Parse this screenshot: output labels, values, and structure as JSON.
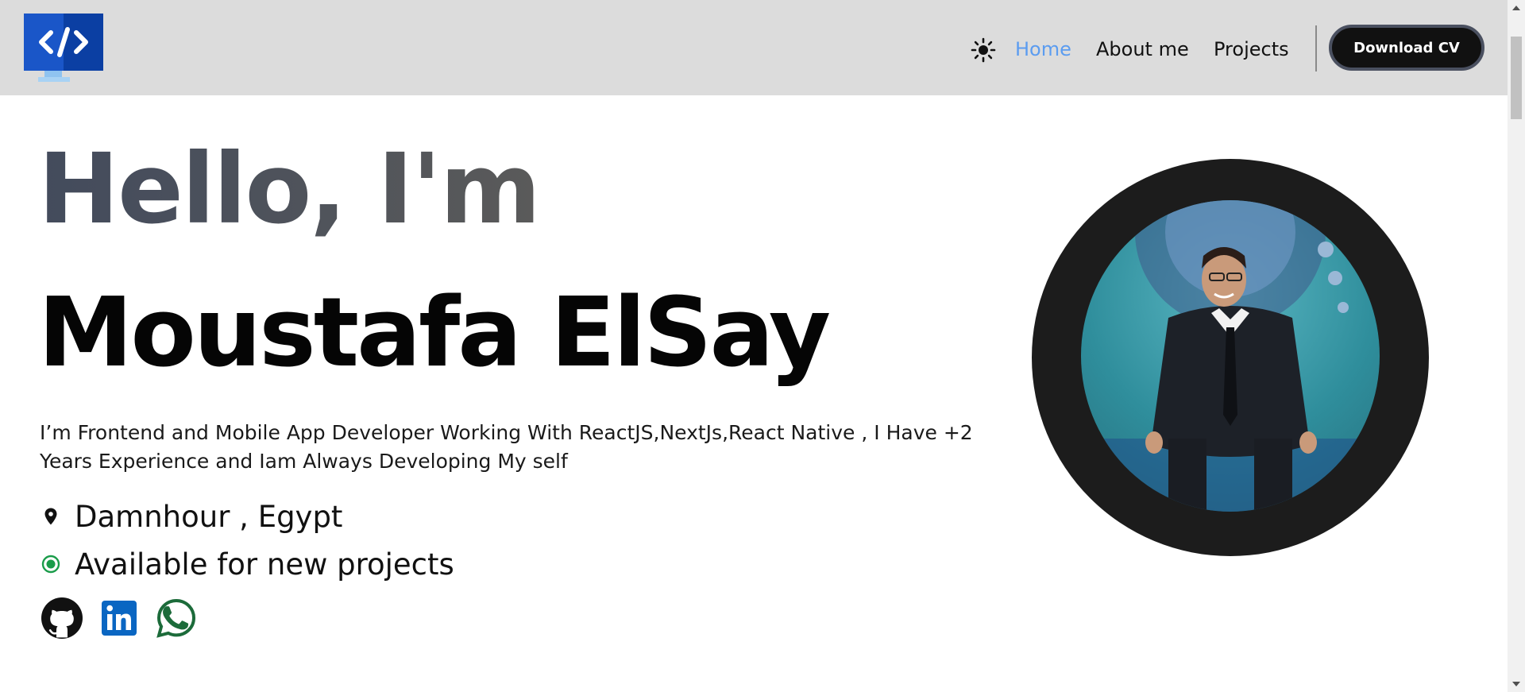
{
  "header": {
    "logo": {
      "icon": "code-monitor-icon",
      "color": "#1a56c8"
    },
    "theme_toggle_icon": "sun-icon",
    "nav": [
      {
        "label": "Home",
        "active": true
      },
      {
        "label": "About me",
        "active": false
      },
      {
        "label": "Projects",
        "active": false
      }
    ],
    "download_cv_label": "Download CV",
    "active_link_color": "#5b9cf0"
  },
  "hero": {
    "greeting": "Hello, I'm",
    "name": "Moustafa ElSay",
    "bio": "I’m Frontend and Mobile App Developer Working With ReactJS,NextJs,React Native , I Have +2 Years Experience and Iam Always Developing My self",
    "location": {
      "icon": "map-pin-icon",
      "text": "Damnhour , Egypt"
    },
    "availability": {
      "icon": "status-dot-icon",
      "text": "Available for new projects",
      "color": "#1a9c4a"
    },
    "socials": [
      {
        "icon": "github-icon",
        "color": "#111111"
      },
      {
        "icon": "linkedin-icon",
        "color": "#0a66c2"
      },
      {
        "icon": "whatsapp-icon",
        "color": "#1c6b3a"
      }
    ]
  },
  "profile_photo": {
    "icon": "profile-photo",
    "ring_color": "#1c1c1c"
  }
}
